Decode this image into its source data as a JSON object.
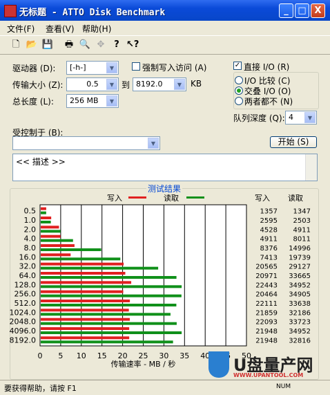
{
  "window": {
    "title": "无标题 - ATTO Disk Benchmark",
    "min": "_",
    "max": "□",
    "close": "X"
  },
  "menu": [
    "文件(F)",
    "查看(V)",
    "帮助(H)"
  ],
  "toolbar_icons": [
    "new-file-icon",
    "open-folder-icon",
    "save-icon",
    "print-icon",
    "print-preview-icon",
    "move-icon",
    "help-icon",
    "context-help-icon"
  ],
  "controls": {
    "drive_label": "驱动器 (D):",
    "drive_value": "[-h-]",
    "force_write_label": "强制写入访问 (A)",
    "direct_io_label": "直接 I/O (R)",
    "direct_io_checked": true,
    "transfer_label": "传输大小 (Z):",
    "transfer_from": "0.5",
    "to_label": "到",
    "transfer_to": "8192.0",
    "kb_label": "KB",
    "length_label": "总长度 (L):",
    "length_value": "256 MB",
    "io_options": [
      "I/O 比较 (C)",
      "交叠 I/O (O)",
      "两者都不 (N)"
    ],
    "io_selected": 1,
    "queue_label": "队列深度 (Q):",
    "queue_value": "4",
    "controlled_label": "受控制于 (B):",
    "start_button": "开始 (S)",
    "description": "<< 描述 >>"
  },
  "results_title": "测试结果",
  "legend": {
    "write": "写入",
    "read": "读取",
    "write_color": "#e02020",
    "read_color": "#10901a"
  },
  "table_headers": {
    "write": "写入",
    "read": "读取"
  },
  "chart_data": {
    "type": "bar",
    "orientation": "horizontal",
    "categories": [
      "0.5",
      "1.0",
      "2.0",
      "4.0",
      "8.0",
      "16.0",
      "32.0",
      "64.0",
      "128.0",
      "256.0",
      "512.0",
      "1024.0",
      "2048.0",
      "4096.0",
      "8192.0"
    ],
    "series": [
      {
        "name": "写入",
        "values": [
          1357,
          2595,
          4528,
          4911,
          8376,
          7413,
          20565,
          20971,
          22443,
          20464,
          22111,
          21859,
          22093,
          21948,
          21948
        ]
      },
      {
        "name": "读取",
        "values": [
          1347,
          2503,
          4911,
          8011,
          14996,
          19739,
          29127,
          33665,
          34952,
          34905,
          33638,
          32186,
          33723,
          34952,
          32816
        ]
      }
    ],
    "xlabel": "传输速率 - MB / 秒",
    "xticks": [
      "0",
      "5",
      "10",
      "15",
      "20",
      "25",
      "30",
      "35",
      "40",
      "45",
      "50"
    ],
    "xlim": [
      0,
      50
    ],
    "grid": true,
    "legend_position": "top"
  },
  "status": {
    "help": "要获得帮助，请按 F1",
    "num": "NUM"
  },
  "watermark": {
    "brand": "U盘量产网",
    "url": "WWW.UPANTOOL.COM"
  }
}
